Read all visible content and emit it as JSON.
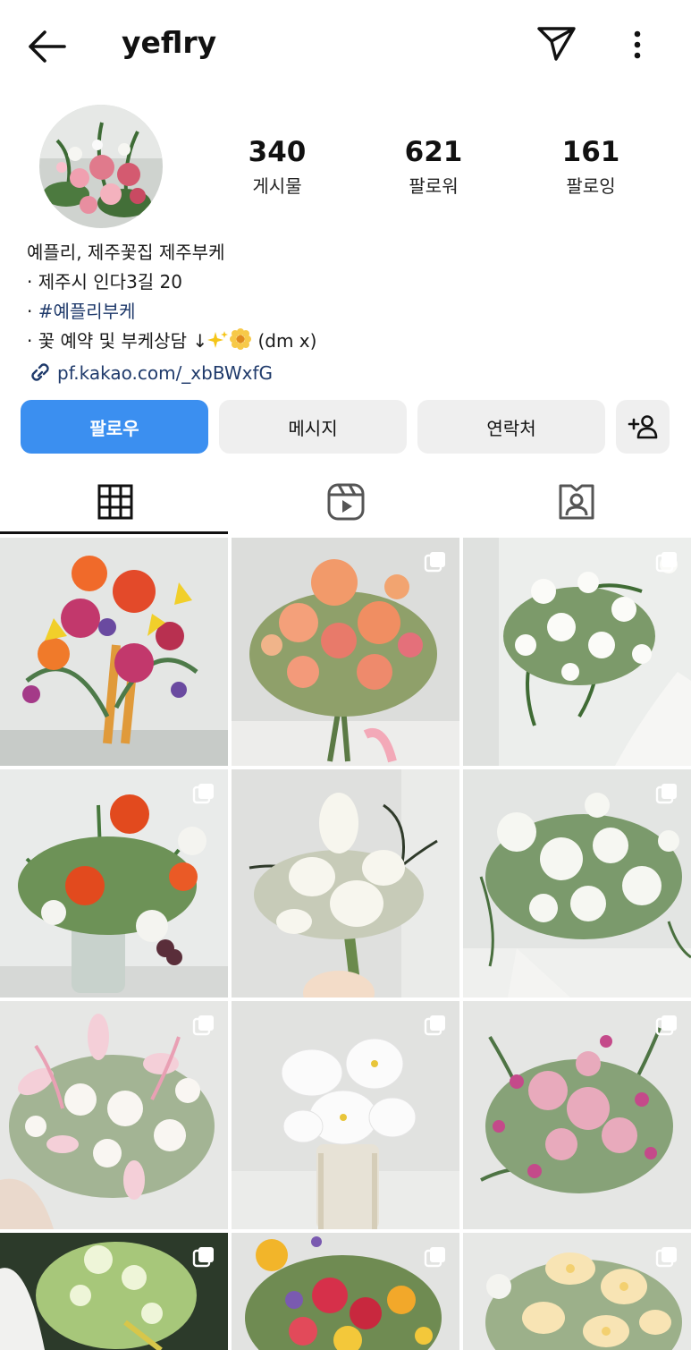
{
  "header": {
    "username": "yeflry",
    "back_icon": "arrow-left-icon",
    "send_icon": "paper-plane-icon",
    "more_icon": "more-vertical-icon"
  },
  "profile": {
    "stats": {
      "posts": {
        "value": "340",
        "label": "게시물"
      },
      "followers": {
        "value": "621",
        "label": "팔로워"
      },
      "following": {
        "value": "161",
        "label": "팔로잉"
      }
    },
    "bio": {
      "name": "예플리, 제주꽃집 제주부케",
      "line1": "· 제주시 인다3길 20",
      "hashtag_prefix": "· ",
      "hashtag": "#예플리부케",
      "line3_text": "· 꽃 예약 및 부케상담 ↓",
      "line3_suffix": " (dm x)",
      "link": "pf.kakao.com/_xbBWxfG"
    }
  },
  "buttons": {
    "follow": "팔로우",
    "message": "메시지",
    "contact": "연락처",
    "add_person_icon": "add-person-icon"
  },
  "tabs": [
    {
      "icon": "grid-icon",
      "active": true
    },
    {
      "icon": "reels-icon",
      "active": false
    },
    {
      "icon": "tagged-user-icon",
      "active": false
    }
  ],
  "colors": {
    "accent": "#3b8ff0",
    "link": "#1f3a6b",
    "button_bg": "#efefef"
  }
}
